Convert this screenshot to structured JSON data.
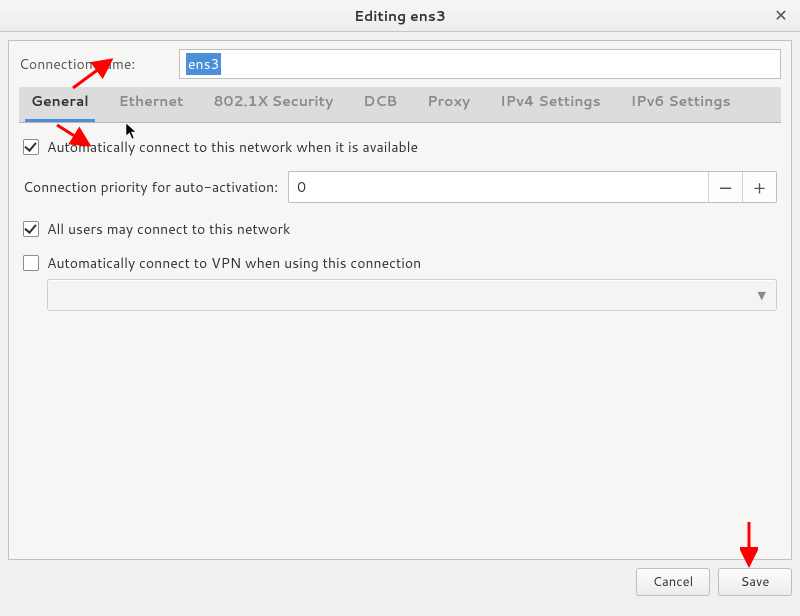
{
  "window": {
    "title": "Editing ens3"
  },
  "connection": {
    "label": "Connection name:",
    "value": "ens3"
  },
  "tabs": [
    {
      "id": "general",
      "label": "General",
      "active": true
    },
    {
      "id": "ethernet",
      "label": "Ethernet",
      "active": false
    },
    {
      "id": "8021x",
      "label": "802.1X Security",
      "active": false
    },
    {
      "id": "dcb",
      "label": "DCB",
      "active": false
    },
    {
      "id": "proxy",
      "label": "Proxy",
      "active": false
    },
    {
      "id": "ipv4",
      "label": "IPv4 Settings",
      "active": false
    },
    {
      "id": "ipv6",
      "label": "IPv6 Settings",
      "active": false
    }
  ],
  "general": {
    "auto_connect_label": "Automatically connect to this network when it is available",
    "auto_connect_checked": true,
    "priority_label": "Connection priority for auto-activation:",
    "priority_value": "0",
    "all_users_label": "All users may connect to this network",
    "all_users_checked": true,
    "auto_vpn_label": "Automatically connect to VPN when using this connection",
    "auto_vpn_checked": false,
    "vpn_selected": ""
  },
  "buttons": {
    "cancel": "Cancel",
    "save": "Save"
  }
}
